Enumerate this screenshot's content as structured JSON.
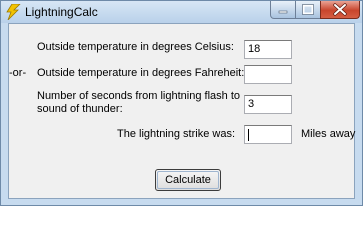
{
  "window": {
    "title": "LightningCalc",
    "app_icon": "lightning-bolt-icon",
    "controls": {
      "minimize_icon": "minimize-icon",
      "maximize_icon": "maximize-icon",
      "close_icon": "close-icon"
    }
  },
  "form": {
    "celsius_label": "Outside temperature in degrees Celsius:",
    "celsius_value": "18",
    "or_label": "-or-",
    "fahrenheit_label": "Outside temperature in degrees Fahreheit:",
    "fahrenheit_value": "",
    "seconds_label_line1": "Number of seconds from lightning flash to",
    "seconds_label_line2": "sound of thunder:",
    "seconds_value": "3",
    "result_label": "The lightning strike was:",
    "result_value": "",
    "result_units": "Miles away",
    "calculate_label": "Calculate"
  },
  "colors": {
    "frame": "#c7dbef",
    "client_bg": "#f0f0f0",
    "close_button": "#c8452d"
  }
}
